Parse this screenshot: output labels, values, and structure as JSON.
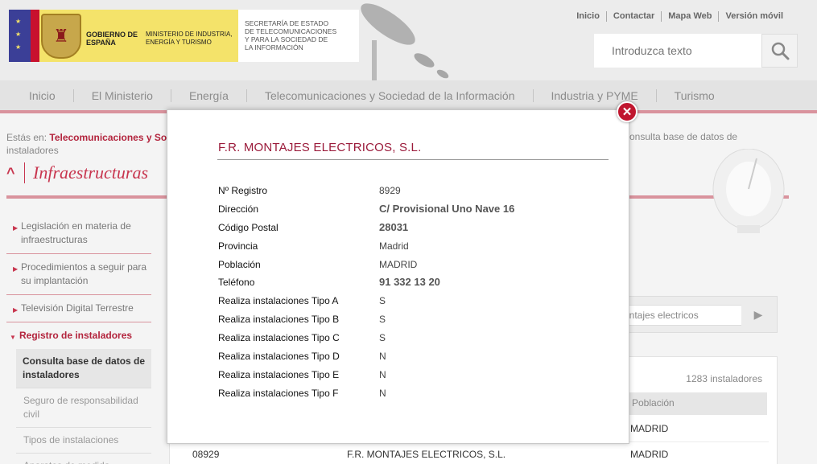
{
  "header": {
    "gobierno": "GOBIERNO DE ESPAÑA",
    "ministerio": "MINISTERIO DE INDUSTRIA, ENERGÍA Y TURISMO",
    "secretaria": "SECRETARÍA DE ESTADO\nDE TELECOMUNICACIONES\nY PARA LA SOCIEDAD DE\nLA INFORMACIÓN",
    "top_links": [
      "Inicio",
      "Contactar",
      "Mapa Web",
      "Versión móvil"
    ],
    "search_placeholder": "Introduzca texto"
  },
  "nav": [
    "Inicio",
    "El Ministerio",
    "Energía",
    "Telecomunicaciones y Sociedad de la Información",
    "Industria y PYME",
    "Turismo"
  ],
  "breadcrumb": {
    "prefix": "Estás en:",
    "link": "Telecomunicaciones y So",
    "tail": "onsulta base de datos de",
    "line2": "instaladores"
  },
  "page_title": "Infraestructuras",
  "sidebar": {
    "items": [
      "Legislación en materia de infraestructuras",
      "Procedimientos a seguir para su implantación",
      "Televisión Digital Terrestre"
    ],
    "active": "Registro de instaladores",
    "subitems": [
      "Consulta base de datos de instaladores",
      "Seguro de responsabilidad civil",
      "Tipos de instalaciones",
      "Aparatos de medida"
    ]
  },
  "filter": {
    "value": "ontajes electricos"
  },
  "results": {
    "count": "1283 instaladores",
    "col_poblacion": "Población",
    "rows": [
      {
        "reg": "",
        "name": "",
        "pob": "MADRID"
      },
      {
        "reg": "08929",
        "name": "F.R. MONTAJES ELECTRICOS, S.L.",
        "pob": "MADRID"
      }
    ]
  },
  "modal": {
    "title": "F.R. MONTAJES ELECTRICOS, S.L.",
    "fields": [
      {
        "label": "Nº Registro",
        "value": "8929",
        "bold": false
      },
      {
        "label": "Dirección",
        "value": "C/ Provisional Uno Nave 16",
        "bold": true
      },
      {
        "label": "Código Postal",
        "value": "28031",
        "bold": true
      },
      {
        "label": "Provincia",
        "value": "Madrid",
        "bold": false
      },
      {
        "label": "Población",
        "value": "MADRID",
        "bold": false
      },
      {
        "label": "Teléfono",
        "value": " 91 332 13 20",
        "bold": true
      },
      {
        "label": "Realiza instalaciones Tipo A",
        "value": "S",
        "bold": false
      },
      {
        "label": "Realiza instalaciones Tipo B",
        "value": "S",
        "bold": false
      },
      {
        "label": "Realiza instalaciones Tipo C",
        "value": "S",
        "bold": false
      },
      {
        "label": "Realiza instalaciones Tipo D",
        "value": "N",
        "bold": false
      },
      {
        "label": "Realiza instalaciones Tipo E",
        "value": "N",
        "bold": false
      },
      {
        "label": "Realiza instalaciones Tipo F",
        "value": "N",
        "bold": false
      }
    ]
  },
  "colors": {
    "accent": "#c8364f",
    "brand_yellow": "#f4e36a",
    "close": "#c0162f",
    "title": "#9b1b3b"
  }
}
